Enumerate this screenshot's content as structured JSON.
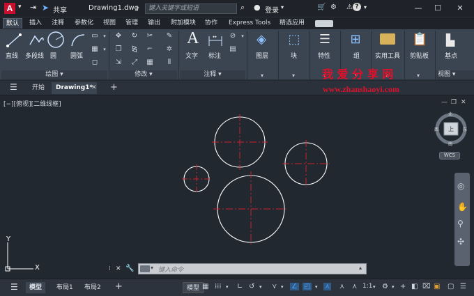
{
  "titlebar": {
    "share": "共享",
    "filename": "Drawing1.dwg",
    "search_placeholder": "键入关键字或短语",
    "login": "登录",
    "help": "?"
  },
  "ribbon_tabs": [
    "默认",
    "插入",
    "注释",
    "参数化",
    "视图",
    "管理",
    "输出",
    "附加模块",
    "协作",
    "Express Tools",
    "精选应用"
  ],
  "draw_panel": {
    "line": "直线",
    "polyline": "多段线",
    "circle": "圆",
    "arc": "圆弧",
    "title": "绘图 ▾"
  },
  "modify_panel": {
    "title": "修改 ▾"
  },
  "annotation_panel": {
    "text": "文字",
    "dimension": "标注",
    "title": "注释 ▾"
  },
  "tools": {
    "layers": "图层",
    "block": "块",
    "properties": "特性",
    "groups": "组",
    "utilities": "实用工具",
    "clipboard": "剪贴板",
    "base": "基点",
    "view_title": "视图 ▾"
  },
  "doc_tabs": {
    "start": "开始",
    "drawing": "Drawing1*"
  },
  "viewport": {
    "label": "[−][俯视][二维线框]"
  },
  "viewcube": {
    "north": "北",
    "south": "南",
    "east": "东",
    "west": "西",
    "top": "上",
    "wcs": "WCS"
  },
  "ucs": {
    "x": "X",
    "y": "Y"
  },
  "command": {
    "placeholder": "键入命令"
  },
  "status": {
    "model_tab": "模型",
    "layout1": "布局1",
    "layout2": "布局2",
    "model_btn": "模型",
    "scale": "1:1"
  },
  "watermark": {
    "cn": "我 爱 分 享 网",
    "url": "www.zhanshaoyi.com"
  },
  "colors": {
    "accent": "#4aa3ff",
    "app_red": "#c8102e",
    "watermark_red": "#e0102a"
  }
}
